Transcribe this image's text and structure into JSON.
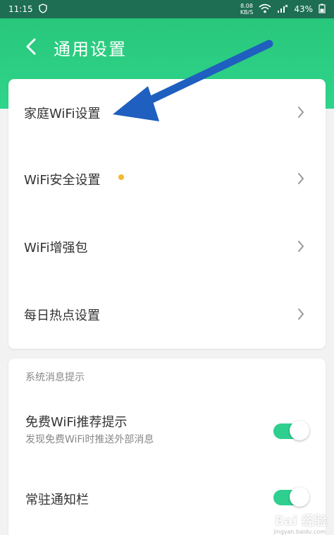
{
  "status_bar": {
    "time": "11:15",
    "speed_value": "8.08",
    "speed_unit": "KB/S",
    "battery": "43%"
  },
  "header": {
    "title": "通用设置"
  },
  "settings_list": [
    {
      "label": "家庭WiFi设置"
    },
    {
      "label": "WiFi安全设置",
      "has_dot": true
    },
    {
      "label": "WiFi增强包"
    },
    {
      "label": "每日热点设置"
    }
  ],
  "notifications": {
    "section_label": "系统消息提示",
    "items": [
      {
        "title": "免费WiFi推荐提示",
        "subtitle": "发现免费WiFi时推送外部消息",
        "enabled": true
      },
      {
        "title": "常驻通知栏",
        "enabled": true
      }
    ]
  },
  "watermark": {
    "text": "Bai 经验",
    "url": "jingyan.baidu.com"
  },
  "colors": {
    "header_green": "#2fd58a",
    "status_bar": "#1d6e52",
    "toggle_on": "#2fcf8f",
    "dot": "#f5b82e",
    "arrow": "#1f5fbf"
  }
}
